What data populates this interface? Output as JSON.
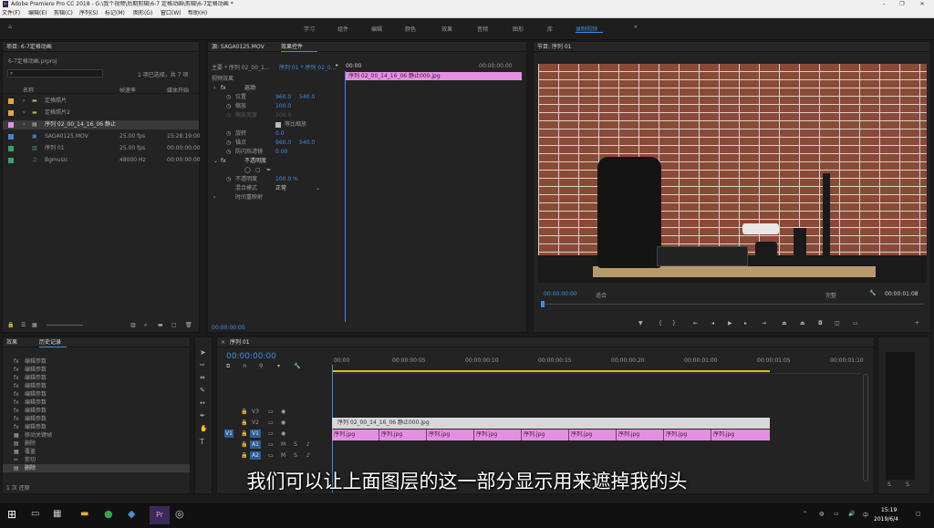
{
  "window": {
    "title": "Adobe Premiere Pro CC 2018 - G:\\我个视频\\后期剪辑\\6-7 定格动画\\剪辑\\6-7定格动画 *"
  },
  "menu": [
    "文件(F)",
    "编辑(E)",
    "剪辑(C)",
    "序列(S)",
    "标记(M)",
    "图形(G)",
    "窗口(W)",
    "帮助(H)"
  ],
  "workspaces": [
    {
      "label": "学习",
      "active": false
    },
    {
      "label": "组件",
      "active": false
    },
    {
      "label": "编辑",
      "active": false
    },
    {
      "label": "颜色",
      "active": false
    },
    {
      "label": "效果",
      "active": false
    },
    {
      "label": "音频",
      "active": false
    },
    {
      "label": "图形",
      "active": false
    },
    {
      "label": "库",
      "active": false
    },
    {
      "label": "录制视频",
      "active": true
    }
  ],
  "project": {
    "title": "项目: 6-7定格动画",
    "file": "6-7定格动画.prproj",
    "count": "1 项已选择，共 7 项",
    "columns": [
      "名称",
      "帧速率",
      "媒体开始"
    ],
    "items": [
      {
        "name": "定格照片",
        "fps": "",
        "start": "",
        "color": "#e7a53a",
        "selected": false
      },
      {
        "name": "定格照片2",
        "fps": "",
        "start": "",
        "color": "#e7a53a",
        "selected": false
      },
      {
        "name": "序列 02_00_14_16_06 静止",
        "fps": "",
        "start": "",
        "color": "#e58fe0",
        "selected": true
      },
      {
        "name": "SAGA0125.MOV",
        "fps": "25.00 fps",
        "start": "15:28:19:00",
        "color": "#4a7fd8",
        "selected": false
      },
      {
        "name": "序列 01",
        "fps": "25.00 fps",
        "start": "00:00:00:00",
        "color": "#3aa36a",
        "selected": false
      },
      {
        "name": "Bgmusic",
        "fps": "48000 Hz",
        "start": "00:00:00:00",
        "color": "#3aa36a",
        "selected": false
      }
    ]
  },
  "effects": {
    "tab_source": "源: SAGA0125.MOV",
    "tab_controls": "效果控件",
    "master": "主要 * 序列 02_00_1...",
    "seq": "序列 01 * 序列 02_0...",
    "time_start": "00:00",
    "time_end": "00:00:00:00",
    "clip": "序列 02_00_14_16_06 静止000.jpg",
    "video_effects": "视频效果",
    "motion": "运动",
    "params": [
      {
        "name": "位置",
        "v1": "960.0",
        "v2": "540.0"
      },
      {
        "name": "缩放",
        "v1": "100.0",
        "v2": ""
      },
      {
        "name": "缩放宽度",
        "v1": "100.0",
        "v2": ""
      },
      {
        "name": "旋转",
        "v1": "0.0",
        "v2": ""
      },
      {
        "name": "锚点",
        "v1": "960.0",
        "v2": "540.0"
      },
      {
        "name": "防闪烁滤镜",
        "v1": "0.00",
        "v2": ""
      }
    ],
    "uniform_scale": "等比缩放",
    "opacity": "不透明度",
    "opacity_label": "不透明度",
    "opacity_value": "100.0 %",
    "blend_label": "混合模式",
    "blend_value": "正常",
    "time_remap": "时间重映射",
    "bottom_time": "00:00:00:00"
  },
  "program": {
    "title": "节目: 序列 01",
    "timecode": "00:00:00:00",
    "fit": "适合",
    "quality": "完整",
    "duration": "00:00:01:08"
  },
  "history": {
    "tab_effects": "效果",
    "tab_history": "历史记录",
    "items": [
      "编辑参数",
      "编辑参数",
      "编辑参数",
      "编辑参数",
      "编辑参数",
      "编辑参数",
      "编辑参数",
      "编辑参数",
      "编辑参数",
      "移动关键帧",
      "删除",
      "覆盖",
      "剪切",
      "删除"
    ],
    "footer": "1 次 还原"
  },
  "timeline": {
    "title": "序列 01",
    "timecode": "00:00:00:00",
    "ruler": [
      "00:00",
      "00:00:00:05",
      "00:00:00:10",
      "00:00:00:15",
      "00:00:00:20",
      "00:00:01:00",
      "00:00:01:05",
      "00:00:01:10"
    ],
    "tracks": [
      {
        "id": "V3"
      },
      {
        "id": "V2"
      },
      {
        "id": "V1"
      },
      {
        "id": "A1"
      },
      {
        "id": "A2"
      }
    ],
    "v2_clip": "序列 02_00_14_16_06 静止000.jpg",
    "v1_clips": [
      "序列.jpg",
      "序列.jpg",
      "序列.jpg",
      "序列.jpg",
      "序列.jpg",
      "序列.jpg",
      "序列.jpg",
      "序列.jpg",
      "序列.jpg"
    ]
  },
  "subtitle": "我们可以让上面图层的这一部分显示用来遮掉我的头",
  "taskbar": {
    "time": "15:19",
    "date": "2019/6/4"
  }
}
